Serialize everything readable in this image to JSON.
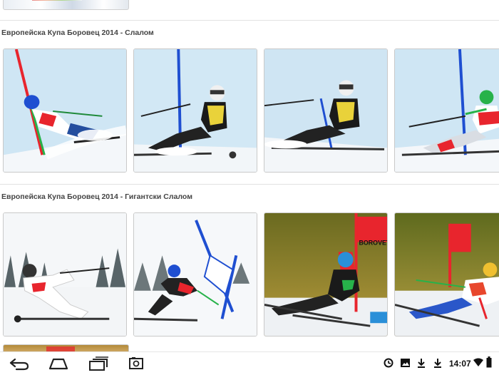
{
  "sections": [
    {
      "title": "Европейска Купа Боровец 2014 - Слалом",
      "photos": [
        {
          "alt": "slalom-skier-1"
        },
        {
          "alt": "slalom-skier-2"
        },
        {
          "alt": "slalom-skier-3"
        },
        {
          "alt": "slalom-skier-4"
        }
      ]
    },
    {
      "title": "Европейска Купа Боровец 2014 - Гигантски Слалом",
      "photos": [
        {
          "alt": "gs-skier-1"
        },
        {
          "alt": "gs-skier-2"
        },
        {
          "alt": "gs-skier-3"
        },
        {
          "alt": "gs-skier-4"
        }
      ]
    }
  ],
  "banner_text": "BOROVET",
  "status_bar": {
    "clock": "14:07",
    "icons": [
      "sync-icon",
      "gallery-icon",
      "download-icon",
      "download-done-icon",
      "wifi-icon",
      "battery-icon"
    ]
  },
  "nav_buttons": [
    "back-icon",
    "home-icon",
    "recent-apps-icon",
    "screenshot-icon"
  ],
  "colors": {
    "gate_red": "#e8252d",
    "gate_blue": "#1f4fd1",
    "gate_green": "#27b24a",
    "sky_blue": "#cfe6f4",
    "snow": "#f4f7fa"
  }
}
